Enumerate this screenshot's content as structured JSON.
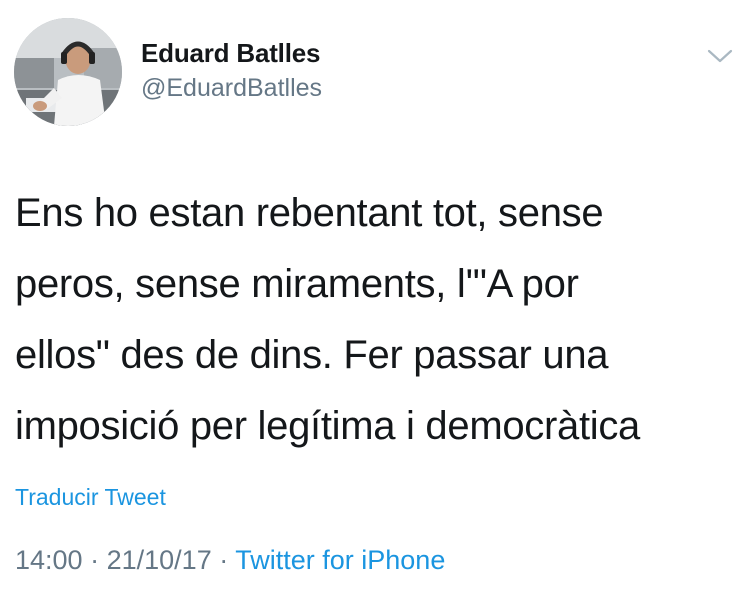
{
  "author": {
    "display_name": "Eduard Batlles",
    "handle": "@EduardBatlles"
  },
  "tweet": {
    "text": "Ens ho estan rebentant tot, sense\nperos, sense miraments, l'\"A por\nellos\" des de dins. Fer passar una\nimposició per legítima i democràtica",
    "translate_label": "Traducir Tweet",
    "time": "14:00",
    "separator": "·",
    "date": "21/10/17",
    "source": "Twitter for iPhone"
  },
  "icons": {
    "menu": "chevron-down-icon",
    "avatar": "avatar-photo"
  },
  "colors": {
    "text": "#14171a",
    "secondary": "#657786",
    "link": "#1b95e0",
    "background": "#ffffff"
  }
}
